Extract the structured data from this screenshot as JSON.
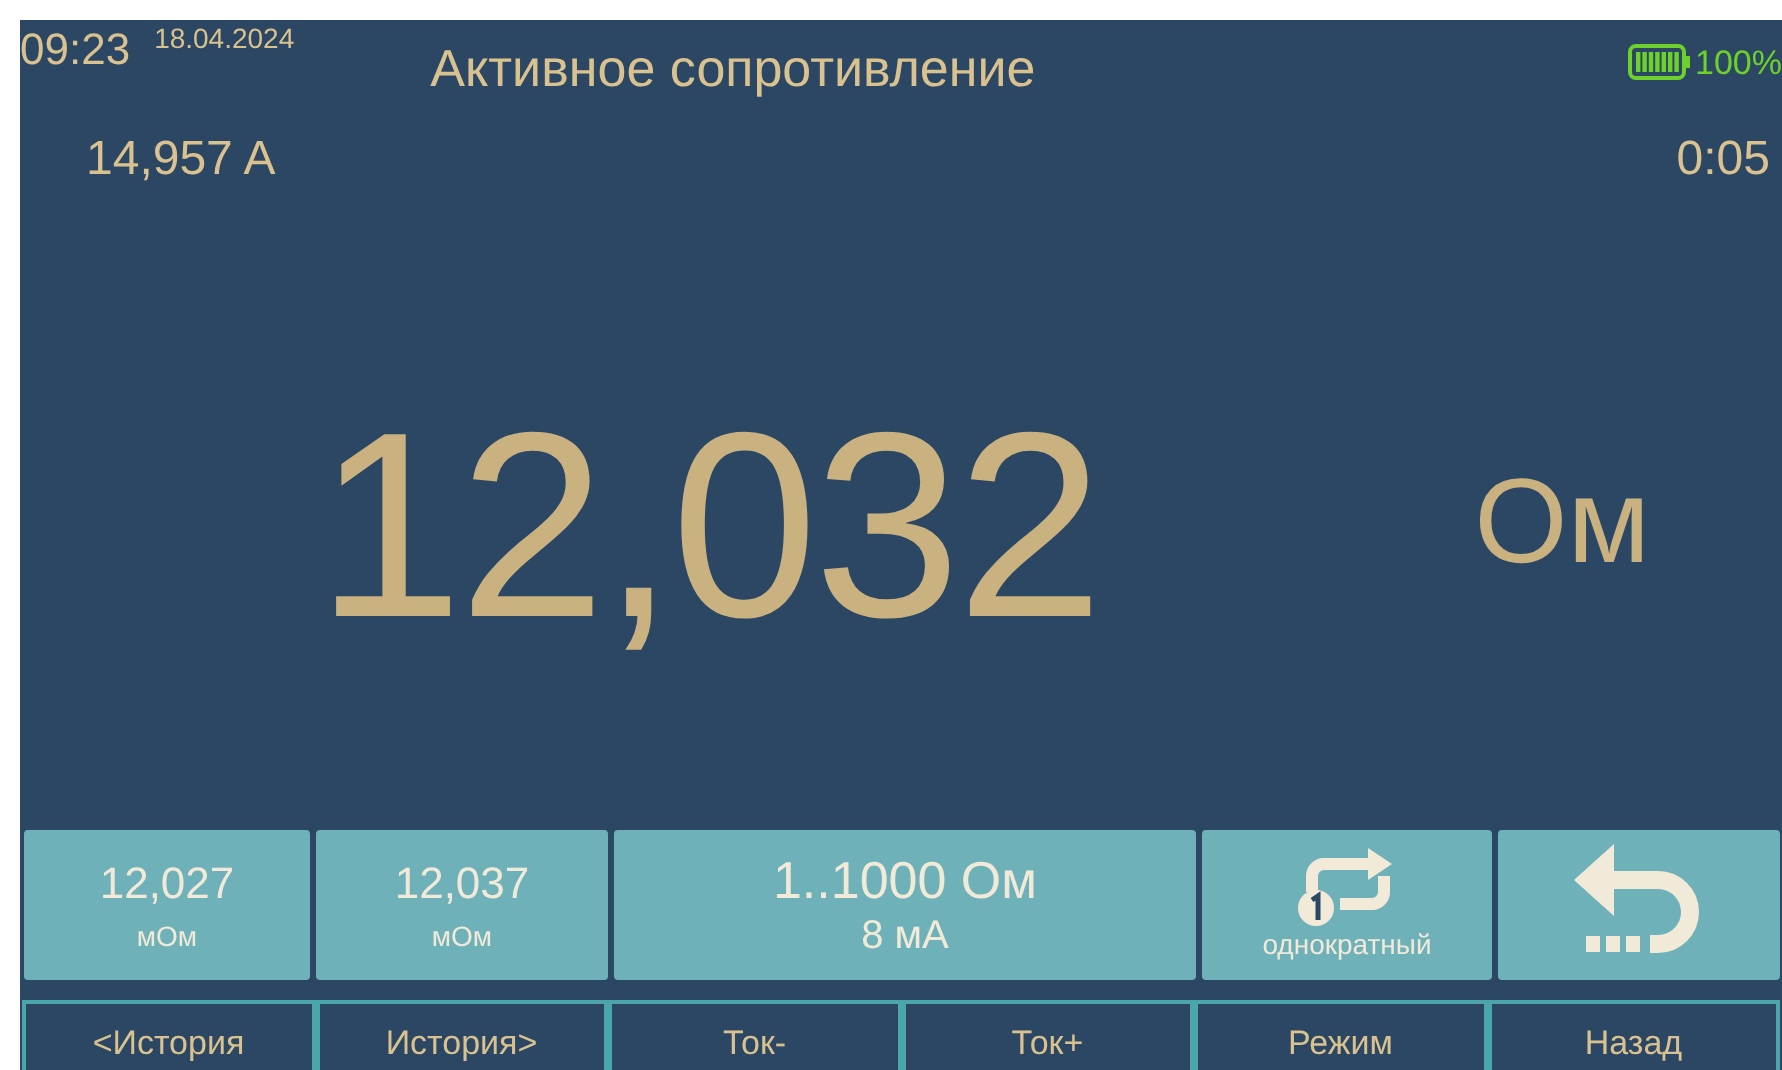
{
  "status_bar": {
    "time": "09:23",
    "date": "18.04.2024",
    "title": "Активное сопротивление",
    "battery": "100%"
  },
  "readings": {
    "current": "14,957 A",
    "timer": "0:05"
  },
  "measurement": {
    "value": "12,032",
    "unit": "Ом"
  },
  "panel": [
    {
      "kind": "value",
      "value": "12,027",
      "unit": "мОм"
    },
    {
      "kind": "value",
      "value": "12,037",
      "unit": "мОм"
    },
    {
      "kind": "range",
      "range": "1..1000 Ом",
      "current": "8 мА"
    },
    {
      "kind": "mode",
      "label": "однократный"
    },
    {
      "kind": "back"
    }
  ],
  "softkeys": [
    "<История",
    "История>",
    "Ток-",
    "Ток+",
    "Режим",
    "Назад"
  ]
}
